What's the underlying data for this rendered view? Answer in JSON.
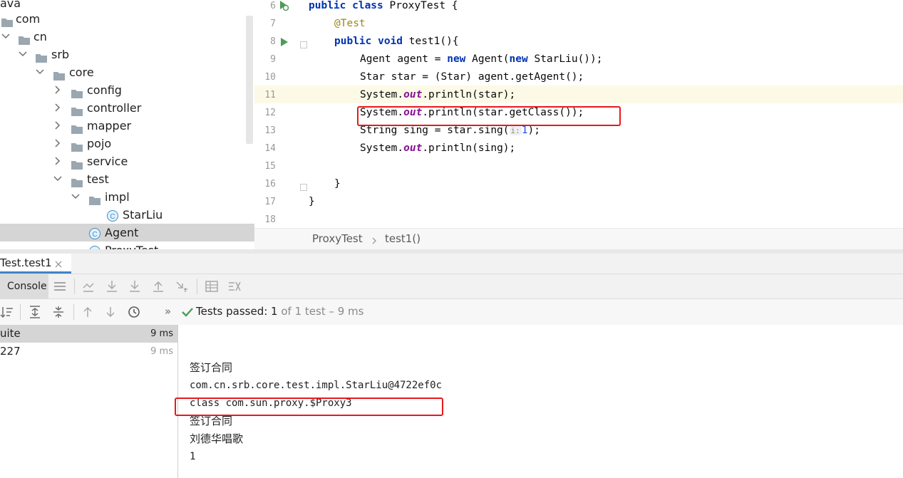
{
  "project_tree": {
    "items": [
      {
        "label": "ava",
        "icon": "folder-icon"
      },
      {
        "label": "com",
        "icon": "folder-icon"
      },
      {
        "label": "cn",
        "icon": "folder-icon"
      },
      {
        "label": "srb",
        "icon": "folder-icon"
      },
      {
        "label": "core",
        "icon": "folder-icon"
      },
      {
        "label": "config",
        "icon": "folder-icon"
      },
      {
        "label": "controller",
        "icon": "folder-icon"
      },
      {
        "label": "mapper",
        "icon": "folder-icon"
      },
      {
        "label": "pojo",
        "icon": "folder-icon"
      },
      {
        "label": "service",
        "icon": "folder-icon"
      },
      {
        "label": "test",
        "icon": "folder-icon"
      },
      {
        "label": "impl",
        "icon": "folder-icon"
      },
      {
        "label": "StarLiu",
        "icon": "class-icon"
      },
      {
        "label": "Agent",
        "icon": "class-icon"
      },
      {
        "label": "ProxyTest",
        "icon": "test-class-icon"
      }
    ]
  },
  "editor": {
    "line_numbers": [
      "6",
      "7",
      "8",
      "9",
      "10",
      "11",
      "12",
      "13",
      "14",
      "15",
      "16",
      "17",
      "18"
    ],
    "code": {
      "l6_kw": "public class",
      "l6_rest": " ProxyTest {",
      "l7_ann": "@Test",
      "l8_kw": "public void",
      "l8_rest": " test1(){",
      "l9_a": "Agent agent = ",
      "l9_new1": "new",
      "l9_b": " Agent(",
      "l9_new2": "new",
      "l9_c": " StarLiu());",
      "l10": "Star star = (Star) agent.getAgent();",
      "l11_a": "System.",
      "l11_out": "out",
      "l11_b": ".println(star);",
      "l12_a": "System.",
      "l12_out": "out",
      "l12_b": ".println(star.getClass());",
      "l13_a": "String sing = star.sing(",
      "l13_hint": "i:",
      "l13_num": "1",
      "l13_b": ");",
      "l14_a": "System.",
      "l14_out": "out",
      "l14_b": ".println(sing);",
      "l16": "}",
      "l17": "}"
    },
    "breadcrumb": {
      "class": "ProxyTest",
      "method": "test1()"
    }
  },
  "run_panel": {
    "tab_label": "Test.test1",
    "console_tab": "Console",
    "status_prefix": "Tests passed: ",
    "status_passed": "1",
    "status_suffix": " of 1 test – 9 ms",
    "more_glyph": "»",
    "tests": [
      {
        "label": "uite",
        "time": "9 ms"
      },
      {
        "label": "227",
        "time": "9 ms"
      }
    ],
    "console_lines": [
      "签订合同",
      "com.cn.srb.core.test.impl.StarLiu@4722ef0c",
      "class com.sun.proxy.$Proxy3",
      "签订合同",
      "刘德华唱歌",
      "1"
    ]
  },
  "colors": {
    "highlight_box": "#e8191d",
    "passed_green": "#4a9d5b",
    "keyword": "#0033b3"
  }
}
